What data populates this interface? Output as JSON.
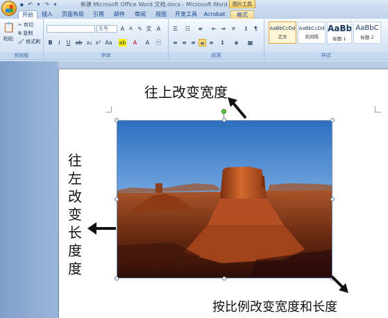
{
  "window": {
    "title": "新建 Microsoft Office Word 文档.docx - Microsoft Word",
    "context_tool": "图片工具"
  },
  "tabs": [
    "开始",
    "插入",
    "页面布局",
    "引用",
    "邮件",
    "审阅",
    "视图",
    "开发工具",
    "Acrobat",
    "格式"
  ],
  "ribbon": {
    "clipboard": {
      "paste_label": "粘贴",
      "cut_label": "剪切",
      "copy_label": "复制",
      "format_painter_label": "格式刷",
      "group_label": "剪贴板"
    },
    "font": {
      "font_size": "五号",
      "group_label": "字体"
    },
    "paragraph": {
      "group_label": "段落"
    },
    "styles": {
      "items": [
        {
          "sample": "AaBbCcDd",
          "name": "正文"
        },
        {
          "sample": "AaBbCcDd",
          "name": "无间隔"
        },
        {
          "sample": "AaBb",
          "name": "标题 1"
        },
        {
          "sample": "AaBbC",
          "name": "标题 2"
        }
      ],
      "group_label": "样式"
    }
  },
  "annotations": {
    "top": "往上改变宽度",
    "left": "往左改变长度度",
    "bottom": "按比例改变宽度和长度"
  },
  "colors": {
    "accent": "#15428b",
    "selection_border": "#e5a53b",
    "rotate_handle": "#62c442"
  }
}
